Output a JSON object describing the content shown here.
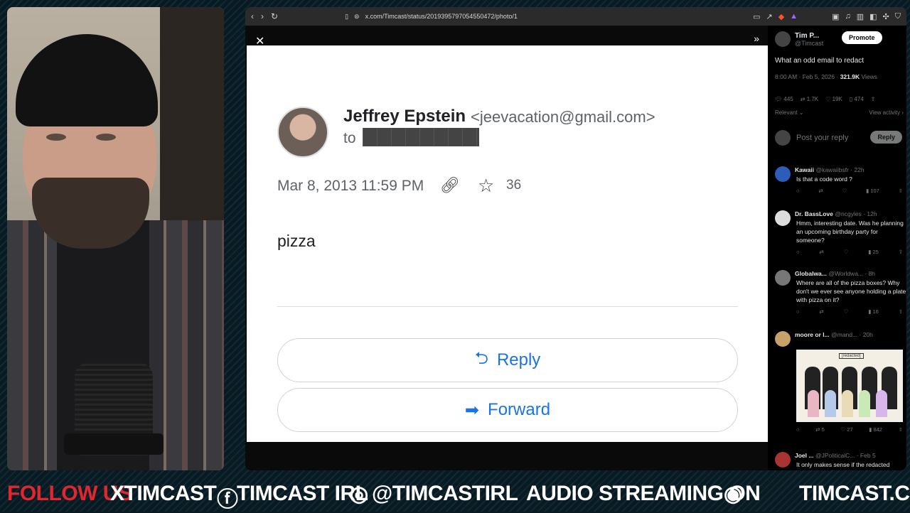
{
  "browser": {
    "url": "x.com/Timcast/status/2019395797054550472/photo/1"
  },
  "email": {
    "sender_name": "Jeffrey Epstein",
    "sender_email": "<jeevacation@gmail.com>",
    "to_label": "to",
    "date": "Mar 8, 2013 11:59 PM",
    "star_count": "36",
    "body": "pizza",
    "reply_label": "Reply",
    "forward_label": "Forward"
  },
  "tweet": {
    "name": "Tim P...",
    "handle": "@Timcast",
    "promote_label": "Promote",
    "text": "What an odd email to redact",
    "timestamp": "8:00 AM · Feb 5, 2026 ·",
    "views": "321.9K",
    "views_label": "Views",
    "replies": "445",
    "reposts": "1.7K",
    "likes": "19K",
    "bookmarks": "474",
    "relevant_label": "Relevant",
    "view_activity": "View activity",
    "post_placeholder": "Post your reply",
    "reply_button": "Reply"
  },
  "replies": [
    {
      "name": "Kawaii",
      "handle": "@kawaiibsfr · 22h",
      "text": "Is that a code word ?",
      "views": "107"
    },
    {
      "name": "Dr. BassLove",
      "handle": "@ncgyles · 12h",
      "text": "Hmm, interesting date. Was he planning an upcoming birthday party for someone?",
      "views": "25"
    },
    {
      "name": "Globalwa...",
      "handle": "@Worldwa... · 8h",
      "text": "Where are all of the pizza boxes? Why don't we ever see anyone holding a plate with pizza on it?",
      "views": "16"
    },
    {
      "name": "moore or l...",
      "handle": "@mand... · 20h",
      "text": "",
      "reposts": "5",
      "likes": "27",
      "views": "842"
    },
    {
      "name": "Joel ...",
      "handle": "@JPoliticalC... · Feb 5",
      "text": "It only makes sense if the redacted person was acting as an asset for"
    }
  ],
  "cartoon_caption": "[redacted]",
  "banner": {
    "follow": "FOLLOW US",
    "x": "XTIMCAST",
    "fb": "TIMCAST IRL",
    "ig": "@TIMCASTIRL",
    "audio": "AUDIO STREAMING ON",
    "site": "TIMCAST.COM"
  }
}
